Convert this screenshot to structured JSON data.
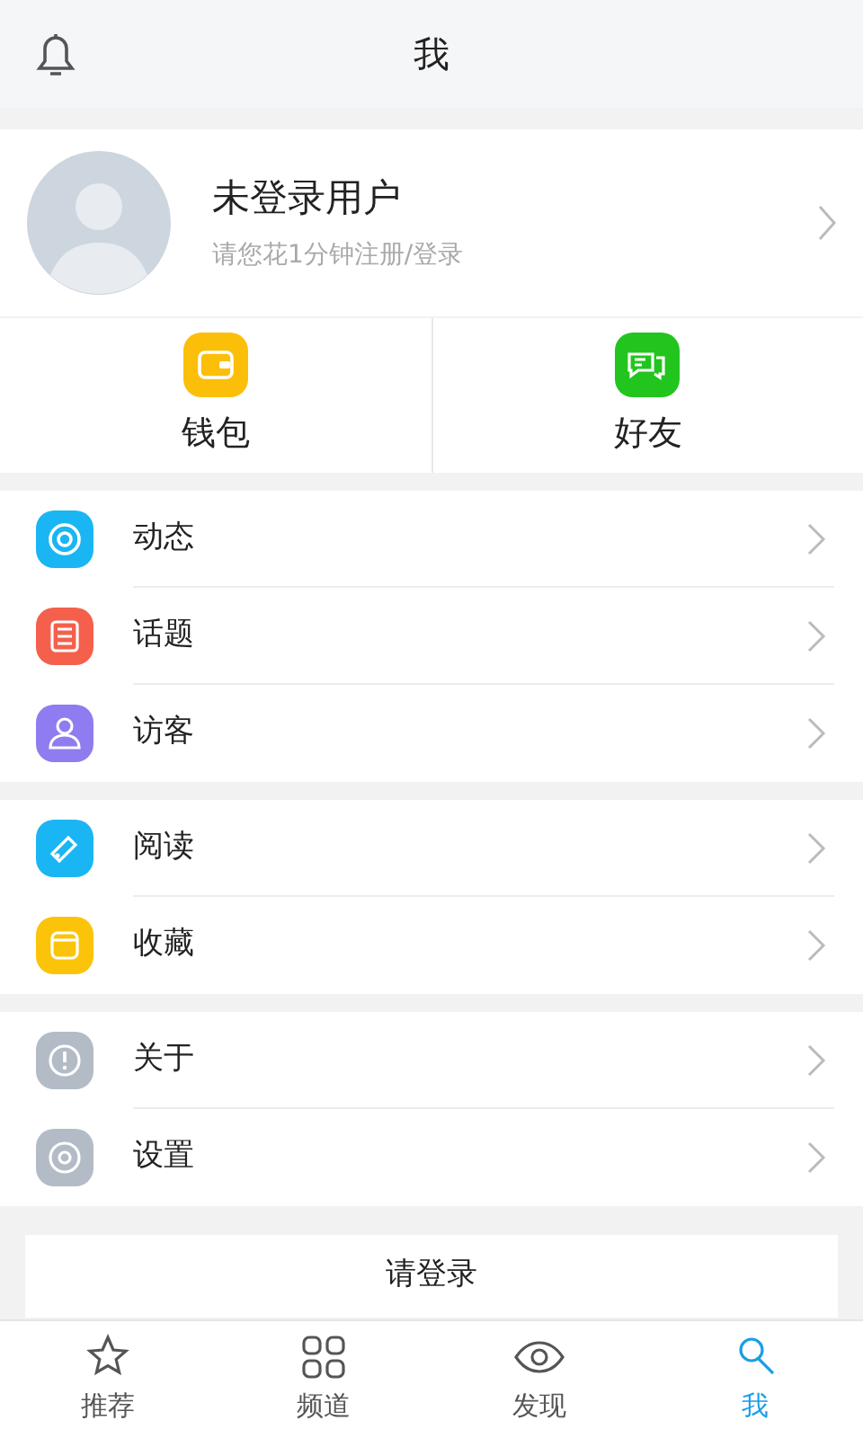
{
  "header": {
    "title": "我"
  },
  "profile": {
    "name": "未登录用户",
    "subtitle": "请您花1分钟注册/登录"
  },
  "shortcuts": [
    {
      "label": "钱包",
      "color": "#fbbf0a"
    },
    {
      "label": "好友",
      "color": "#22c51e"
    }
  ],
  "menu_groups": [
    [
      {
        "label": "动态",
        "color": "#1ab6f3"
      },
      {
        "label": "话题",
        "color": "#f4604c"
      },
      {
        "label": "访客",
        "color": "#8f7cf0"
      }
    ],
    [
      {
        "label": "阅读",
        "color": "#1ab6f3"
      },
      {
        "label": "收藏",
        "color": "#fbc40a"
      }
    ],
    [
      {
        "label": "关于",
        "color": "#b3bcc6"
      },
      {
        "label": "设置",
        "color": "#b3bcc6"
      }
    ]
  ],
  "login_button": "请登录",
  "tabs": [
    {
      "label": "推荐",
      "selected": false
    },
    {
      "label": "频道",
      "selected": false
    },
    {
      "label": "发现",
      "selected": false
    },
    {
      "label": "我",
      "selected": true
    }
  ]
}
